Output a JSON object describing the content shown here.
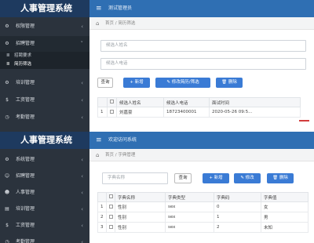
{
  "brand": {
    "p1": "人事管理系统",
    "p2": "人事管理系统"
  },
  "topbar": {
    "p1_title": "测试管理员",
    "p2_title": "欢迎访问系统"
  },
  "icons": {
    "menu": "hamburger-icon",
    "home": "home-icon",
    "chevron": "chevron-left-icon",
    "sidebar_generic": "gear-icon"
  },
  "p1": {
    "sidebar": [
      {
        "label": "权限管理",
        "chevron": "‹"
      },
      {
        "label": "招聘管理",
        "chevron": "‹"
      }
    ],
    "submenu": [
      {
        "label": "招聘要求"
      },
      {
        "label": "简历筛选"
      }
    ],
    "sidebar_after": [
      {
        "label": "培训管理",
        "chevron": "‹"
      },
      {
        "label": "工资管理",
        "chevron": "‹"
      },
      {
        "label": "考勤管理",
        "chevron": "‹"
      }
    ],
    "crumb": "首页  /  简历筛选",
    "inputs": {
      "name_placeholder": "候选人姓名",
      "phone_placeholder": "候选人电话"
    },
    "buttons": {
      "query": "查询",
      "add": "+ 新增",
      "approve": "✎ 修改简历/筛选",
      "delete": "🗑 删除"
    },
    "table": {
      "headers": [
        "",
        "",
        "候选人姓名",
        "候选人电话",
        "面试时间"
      ],
      "rows": [
        [
          "1",
          "",
          "刘嘉豪",
          "18723400001",
          "2020-05-26 09:5..."
        ]
      ]
    }
  },
  "p2": {
    "sidebar": [
      {
        "label": "系统管理",
        "chevron": "‹"
      },
      {
        "label": "招聘管理",
        "chevron": "‹"
      },
      {
        "label": "人事管理",
        "chevron": "‹"
      },
      {
        "label": "培训管理",
        "chevron": "‹"
      },
      {
        "label": "工资管理",
        "chevron": "‹"
      },
      {
        "label": "考勤管理",
        "chevron": "‹"
      }
    ],
    "crumb": "首页  /  字典管理",
    "inputs": {
      "search_placeholder": "字典名称"
    },
    "buttons": {
      "query": "查询",
      "add": "+ 新增",
      "edit": "✎ 修改",
      "delete": "🗑 删除"
    },
    "table": {
      "headers": [
        "",
        "",
        "字典名称",
        "字典类型",
        "字典码",
        "字典值"
      ],
      "rows": [
        [
          "1",
          "",
          "性别",
          "sex",
          "0",
          "女"
        ],
        [
          "2",
          "",
          "性别",
          "sex",
          "1",
          "男"
        ],
        [
          "3",
          "",
          "性别",
          "sex",
          "2",
          "未知"
        ]
      ]
    }
  }
}
